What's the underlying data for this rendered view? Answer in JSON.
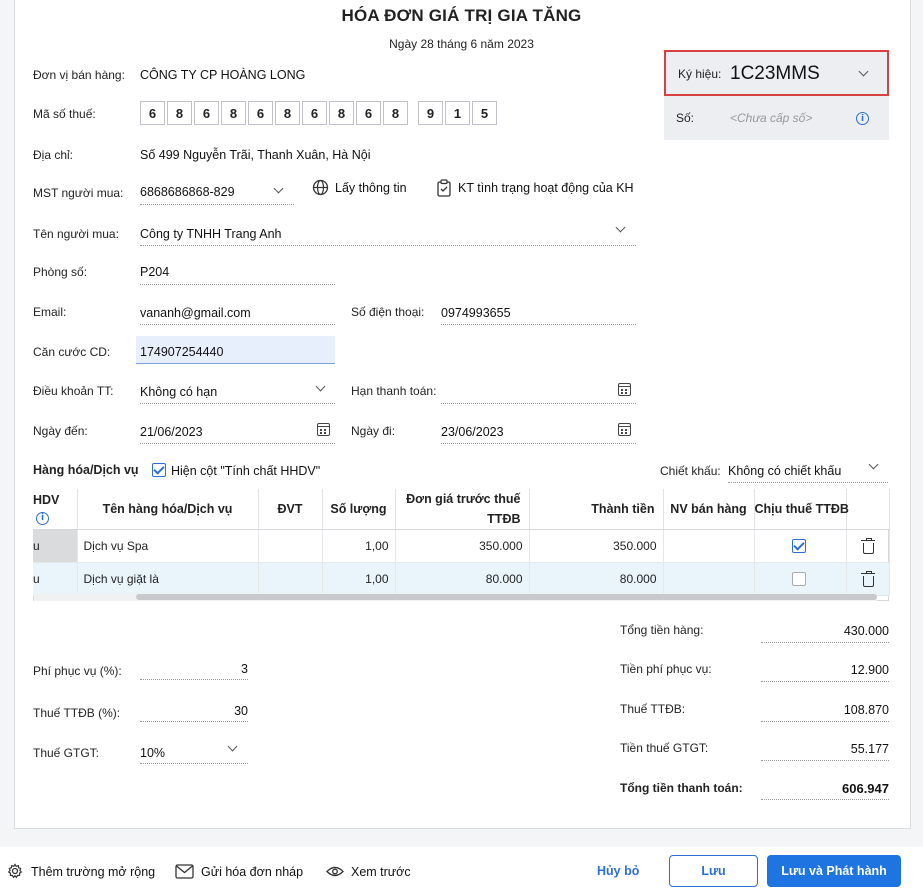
{
  "invoice": {
    "title": "HÓA ĐƠN GIÁ TRỊ GIA TĂNG",
    "date_line": "Ngày 28 tháng 6 năm 2023"
  },
  "symbol_panel": {
    "symbol_label": "Ký hiệu:",
    "symbol_value": "1C23MMS",
    "number_label": "Số:",
    "number_placeholder": "<Chưa cấp số>"
  },
  "seller": {
    "unit_label": "Đơn vị bán hàng:",
    "unit_value": "CÔNG TY CP HOÀNG LONG",
    "tax_label": "Mã số thuế:",
    "tax_digits": [
      "6",
      "8",
      "6",
      "8",
      "6",
      "8",
      "6",
      "8",
      "6",
      "8"
    ],
    "tax_suffix": [
      "9",
      "1",
      "5"
    ],
    "address_label": "Địa chỉ:",
    "address_value": "Số 499 Nguyễn Trãi, Thanh Xuân, Hà Nội"
  },
  "buyer": {
    "mst_label": "MST người mua:",
    "mst_value": "6868686868-829",
    "get_info": "Lấy thông tin",
    "check_status": "KT tình trạng hoạt động của KH",
    "name_label": "Tên người mua:",
    "name_value": "Công ty TNHH Trang Anh",
    "room_label": "Phòng số:",
    "room_value": "P204",
    "email_label": "Email:",
    "email_value": "vananh@gmail.com",
    "phone_label": "Số điện thoại:",
    "phone_value": "0974993655",
    "id_label": "Căn cước CD:",
    "id_value": "174907254440",
    "terms_label": "Điều khoản TT:",
    "terms_value": "Không có hạn",
    "due_label": "Hạn thanh toán:",
    "due_value": "",
    "arrive_label": "Ngày đến:",
    "arrive_value": "21/06/2023",
    "leave_label": "Ngày đi:",
    "leave_value": "23/06/2023"
  },
  "goods": {
    "section_label": "Hàng hóa/Dịch vụ",
    "show_col_label": "Hiện cột \"Tính chất HHDV\"",
    "discount_label": "Chiết khấu:",
    "discount_value": "Không có chiết khấu",
    "columns": [
      "HDV",
      "Tên hàng hóa/Dịch vụ",
      "ĐVT",
      "Số lượng",
      "Đơn giá trước thuế TTĐB",
      "Thành tiền",
      "NV bán hàng",
      "Chịu thuế TTĐB"
    ],
    "rows": [
      {
        "type": "u",
        "name": "Dịch vụ Spa",
        "unit": "",
        "qty": "1,00",
        "price": "350.000",
        "amount": "350.000",
        "staff": "",
        "taxable": true
      },
      {
        "type": "u",
        "name": "Dịch vụ giặt là",
        "unit": "",
        "qty": "1,00",
        "price": "80.000",
        "amount": "80.000",
        "staff": "",
        "taxable": false
      }
    ]
  },
  "fees": {
    "service_label": "Phí phục vụ (%):",
    "service_value": "3",
    "ttdb_label": "Thuế TTĐB (%):",
    "ttdb_value": "30",
    "vat_label": "Thuế GTGT:",
    "vat_value": "10%"
  },
  "totals": {
    "goods_label": "Tổng tiền hàng:",
    "goods_value": "430.000",
    "service_label": "Tiền phí phục vụ:",
    "service_value": "12.900",
    "ttdb_label": "Thuế TTĐB:",
    "ttdb_value": "108.870",
    "vat_label": "Tiền thuế GTGT:",
    "vat_value": "55.177",
    "grand_label": "Tổng tiền thanh toán:",
    "grand_value": "606.947"
  },
  "footer": {
    "extend": "Thêm trường mở rộng",
    "send_draft": "Gửi hóa đơn nháp",
    "preview": "Xem trước",
    "cancel": "Hủy bỏ",
    "save": "Lưu",
    "save_issue": "Lưu và Phát hành"
  },
  "colors": {
    "accent": "#1e74e0",
    "highlight_border": "#d94040",
    "selected_row": "#e9f4fb"
  }
}
